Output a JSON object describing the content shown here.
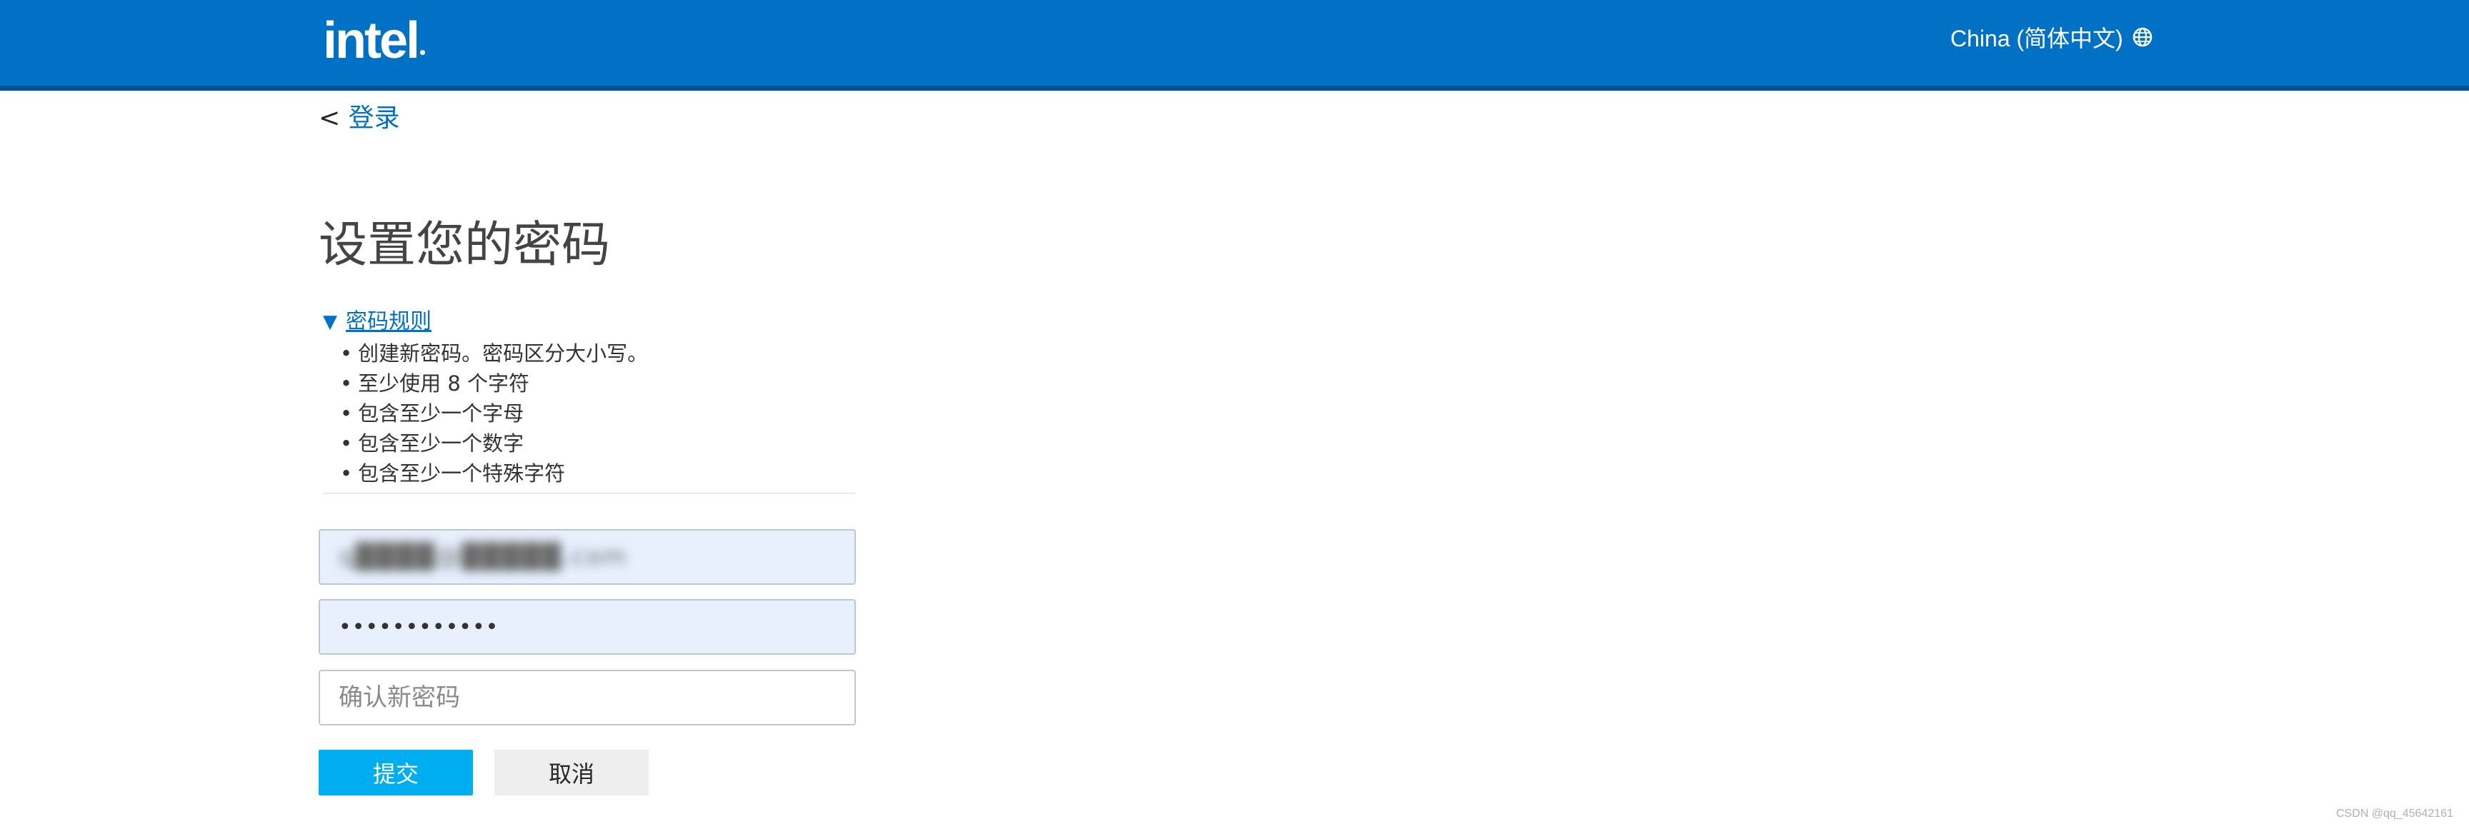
{
  "header": {
    "logo": "intel",
    "locale_label": "China (简体中文)",
    "locale_icon": "globe-icon",
    "colors": {
      "bar": "#0071c5",
      "bar_bottom": "#00519b"
    }
  },
  "nav": {
    "back_prefix": "<",
    "back_label": "登录"
  },
  "page": {
    "title": "设置您的密码"
  },
  "rules": {
    "toggle_icon": "▼",
    "toggle_label": "密码规则",
    "items": [
      "创建新密码。密码区分大小写。",
      "至少使用 8 个字符",
      "包含至少一个字母",
      "包含至少一个数字",
      "包含至少一个特殊字符"
    ]
  },
  "form": {
    "email_value": "q████@█████.com",
    "password_value": "••••••••••••",
    "confirm_placeholder": "确认新密码",
    "submit_label": "提交",
    "cancel_label": "取消"
  },
  "watermark": "CSDN @qq_45642161",
  "colors": {
    "accent": "#0071c5",
    "submit": "#00aeef",
    "autofill": "#e8f0fe"
  }
}
